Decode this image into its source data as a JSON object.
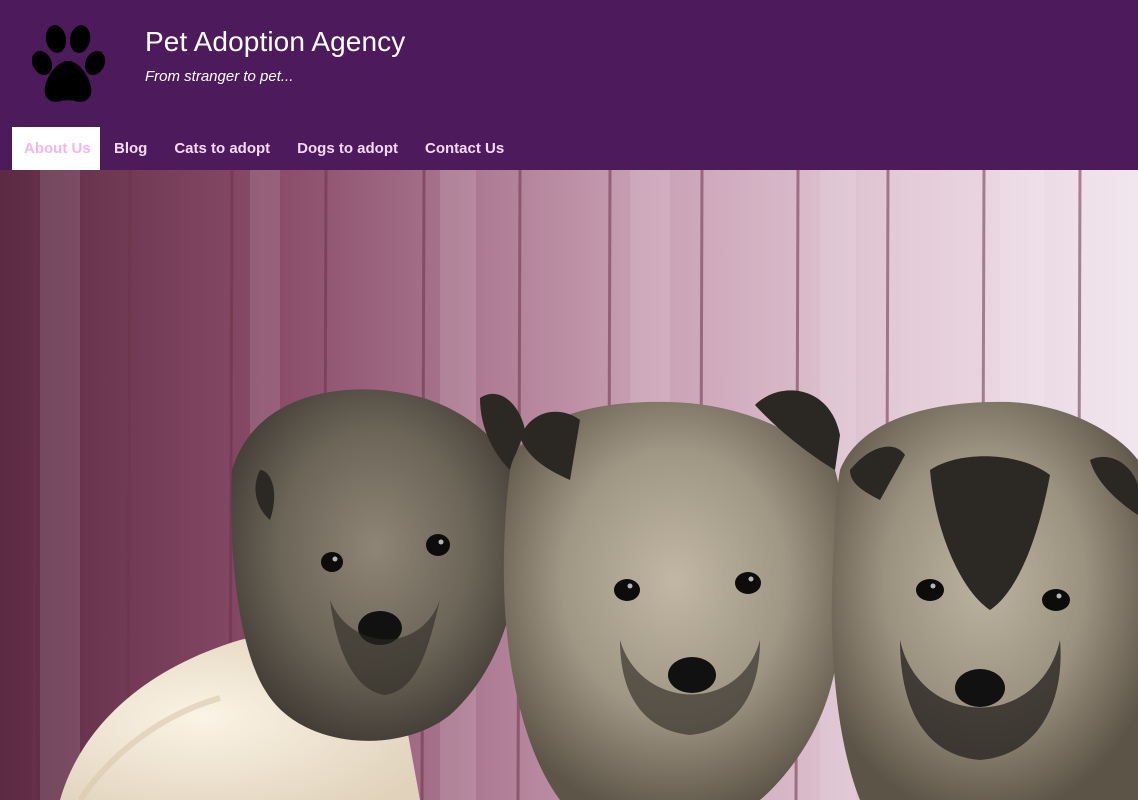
{
  "site": {
    "title": "Pet Adoption Agency",
    "tagline": "From stranger to pet...",
    "logo_icon": "paw-icon"
  },
  "nav": {
    "active_index": 0,
    "items": [
      {
        "label": "About Us"
      },
      {
        "label": "Blog"
      },
      {
        "label": "Cats to adopt"
      },
      {
        "label": "Dogs to adopt"
      },
      {
        "label": "Contact Us"
      }
    ]
  },
  "hero": {
    "subject": "three fluffy puppies in front of a pink wooden wall"
  },
  "colors": {
    "header_bg": "#4d1a5c",
    "nav_text": "#f6d8f4",
    "nav_active_bg": "#ffffff",
    "nav_active_text": "#f2b6ee",
    "title_text": "#ffffff"
  }
}
